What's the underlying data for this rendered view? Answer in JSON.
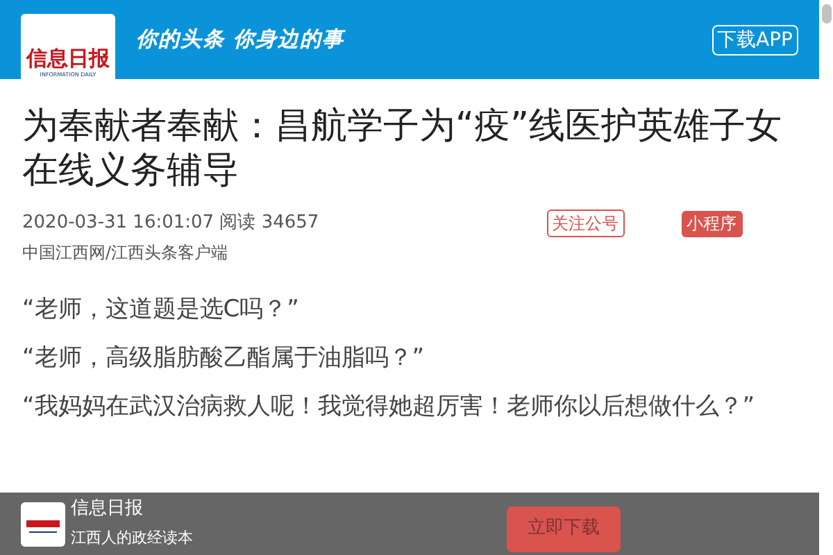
{
  "header": {
    "logo_title": "信息日报",
    "logo_subtitle": "INFORMATION DAILY",
    "slogan": "你的头条 你身边的事",
    "download_button": "下载APP"
  },
  "article": {
    "title": "为奉献者奉献：昌航学子为“疫”线医护英雄子女在线义务辅导",
    "date": "2020-03-31 16:01:07",
    "reads": "阅读 34657",
    "follow_tag": "关注公号",
    "miniprogram_tag": "小程序",
    "source": "中国江西网/江西头条客户端",
    "paragraphs": [
      "“老师，这道题是选C吗？”",
      "“老师，高级脂肪酸乙酯属于油脂吗？”",
      "“我妈妈在武汉治病救人呢！我觉得她超厉害！老师你以后想做什么？”"
    ]
  },
  "banner": {
    "name": "信息日报",
    "tagline": "江西人的政经读本",
    "button": "立即下载"
  }
}
